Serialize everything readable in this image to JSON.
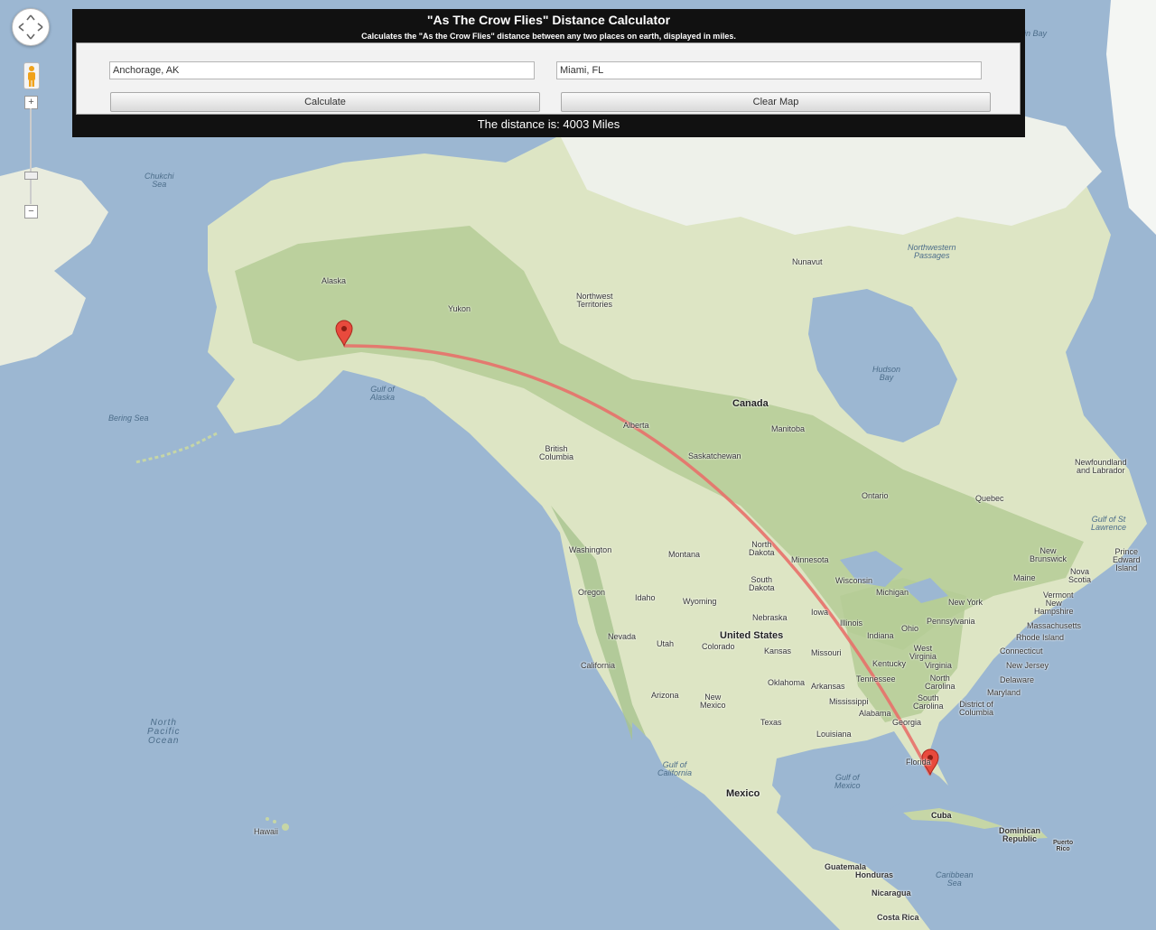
{
  "calculator": {
    "title": "\"As The Crow Flies\" Distance Calculator",
    "subtitle": "Calculates the \"As the Crow Flies\" distance between any two places on earth, displayed in miles.",
    "from_value": "Anchorage, AK",
    "to_value": "Miami, FL",
    "calculate_label": "Calculate",
    "clear_label": "Clear Map",
    "result_text": "The distance is: 4003 Miles"
  },
  "map_controls": {
    "pan_icon": "pan-arrows-icon",
    "pegman_icon": "pegman-icon",
    "zoom_in_label": "+",
    "zoom_out_label": "−"
  },
  "map_labels": {
    "baffin_bay": "Baffin Bay",
    "chukchi_sea": "Chukchi\nSea",
    "alaska": "Alaska",
    "yukon": "Yukon",
    "nw_territories": "Northwest\nTerritories",
    "nunavut": "Nunavut",
    "nw_passages": "Northwestern\nPassages",
    "hudson_bay": "Hudson\nBay",
    "canada": "Canada",
    "alberta": "Alberta",
    "manitoba": "Manitoba",
    "saskatchewan": "Saskatchewan",
    "british_columbia": "British\nColumbia",
    "ontario": "Ontario",
    "quebec": "Quebec",
    "newfoundland": "Newfoundland\nand Labrador",
    "gulf_st_lawrence": "Gulf of St\nLawrence",
    "new_brunswick": "New\nBrunswick",
    "pei": "Prince\nEdward\nIsland",
    "nova_scotia": "Nova\nScotia",
    "gulf_alaska": "Gulf of\nAlaska",
    "bering_sea": "Bering Sea",
    "washington": "Washington",
    "oregon": "Oregon",
    "idaho": "Idaho",
    "montana": "Montana",
    "wyoming": "Wyoming",
    "north_dakota": "North\nDakota",
    "south_dakota": "South\nDakota",
    "minnesota": "Minnesota",
    "wisconsin": "Wisconsin",
    "michigan": "Michigan",
    "maine": "Maine",
    "vermont": "Vermont",
    "new_hampshire": "New\nHampshire",
    "new_york": "New York",
    "massachusetts": "Massachusetts",
    "rhode_island": "Rhode Island",
    "connecticut": "Connecticut",
    "new_jersey": "New Jersey",
    "delaware": "Delaware",
    "maryland": "Maryland",
    "dc": "District of\nColumbia",
    "pennsylvania": "Pennsylvania",
    "ohio": "Ohio",
    "indiana": "Indiana",
    "illinois": "Illinois",
    "iowa": "Iowa",
    "nebraska": "Nebraska",
    "united_states": "United States",
    "nevada": "Nevada",
    "utah": "Utah",
    "colorado": "Colorado",
    "kansas": "Kansas",
    "missouri": "Missouri",
    "kentucky": "Kentucky",
    "west_virginia": "West\nVirginia",
    "virginia": "Virginia",
    "north_carolina": "North\nCarolina",
    "tennessee": "Tennessee",
    "south_carolina": "South\nCarolina",
    "california": "California",
    "arizona": "Arizona",
    "new_mexico": "New\nMexico",
    "oklahoma": "Oklahoma",
    "arkansas": "Arkansas",
    "mississippi": "Mississippi",
    "alabama": "Alabama",
    "georgia": "Georgia",
    "texas": "Texas",
    "louisiana": "Louisiana",
    "florida": "Florida",
    "gulf_california": "Gulf of\nCalifornia",
    "gulf_mexico": "Gulf of\nMexico",
    "mexico": "Mexico",
    "cuba": "Cuba",
    "dominican_republic": "Dominican\nRepublic",
    "puerto_rico": "Puerto\nRico",
    "caribbean_sea": "Caribbean\nSea",
    "guatemala": "Guatemala",
    "honduras": "Honduras",
    "nicaragua": "Nicaragua",
    "costa_rica": "Costa Rica",
    "north_pacific": "North\nPacific\nOcean",
    "hawaii": "Hawaii"
  },
  "colors": {
    "water": "#9cb7d2",
    "land": "#dde5c4",
    "forest": "#a7c38e",
    "ice": "#f1f4f2",
    "route": "#e8706a",
    "marker": "#e84a3d"
  }
}
